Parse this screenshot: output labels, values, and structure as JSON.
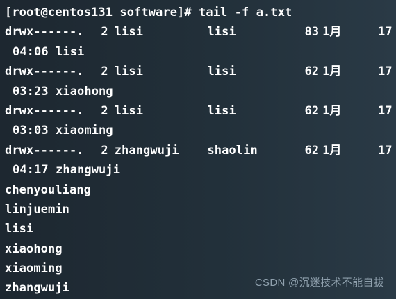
{
  "terminal": {
    "prompt": "[root@centos131 software]# tail -f a.txt",
    "entries": [
      {
        "perm": "drwx------.",
        "links": "2",
        "user": "lisi",
        "group": "lisi",
        "size": "83",
        "month": "1月",
        "day": "17",
        "time": "04:06",
        "name": "lisi"
      },
      {
        "perm": "drwx------.",
        "links": "2",
        "user": "lisi",
        "group": "lisi",
        "size": "62",
        "month": "1月",
        "day": "17",
        "time": "03:23",
        "name": "xiaohong"
      },
      {
        "perm": "drwx------.",
        "links": "2",
        "user": "lisi",
        "group": "lisi",
        "size": "62",
        "month": "1月",
        "day": "17",
        "time": "03:03",
        "name": "xiaoming"
      },
      {
        "perm": "drwx------.",
        "links": "2",
        "user": "zhangwuji",
        "group": "shaolin",
        "size": "62",
        "month": "1月",
        "day": "17",
        "time": "04:17",
        "name": "zhangwuji"
      }
    ],
    "names": [
      "chenyouliang",
      "linjuemin",
      "lisi",
      "xiaohong",
      "xiaoming",
      "zhangwuji"
    ]
  },
  "watermark": "CSDN @沉迷技术不能自拔"
}
